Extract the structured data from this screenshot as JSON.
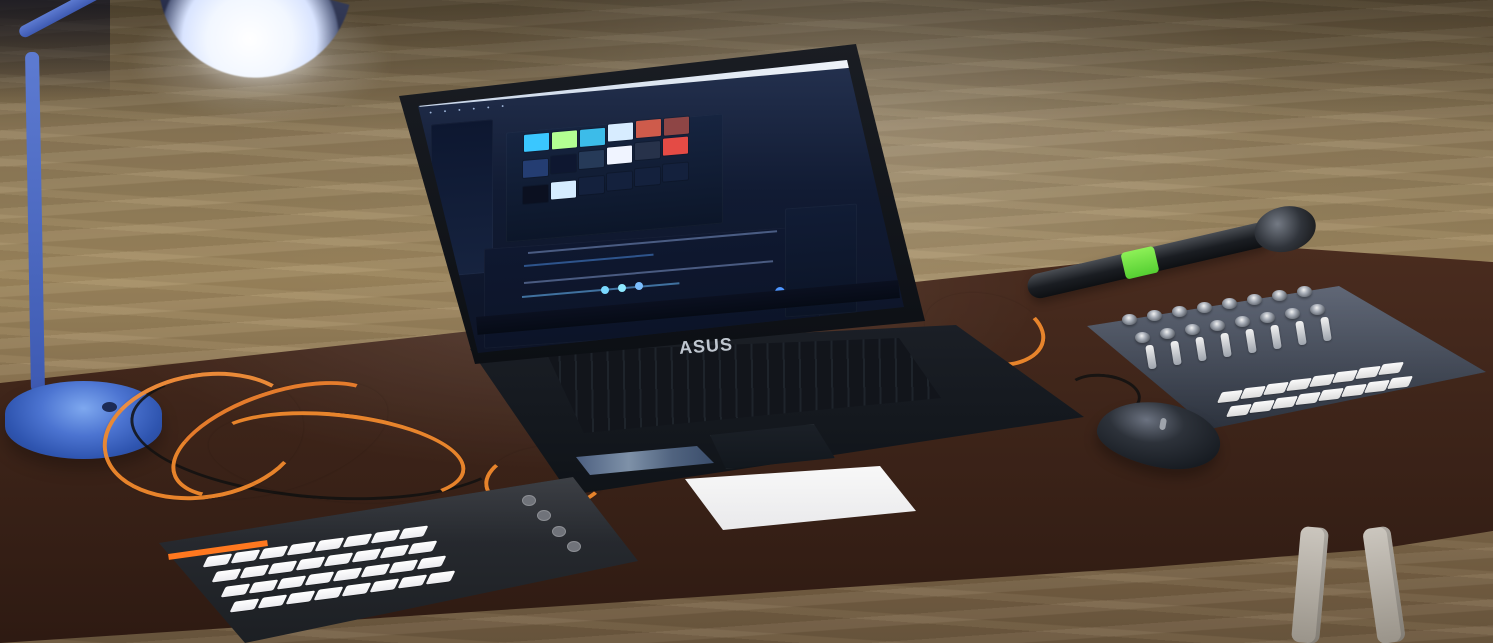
{
  "scene": {
    "brand_label": "ASUS"
  },
  "icons": [
    "lamp-icon",
    "laptop-icon",
    "grid-controller-icon",
    "mixer-controller-icon",
    "microphone-icon",
    "mouse-icon"
  ]
}
